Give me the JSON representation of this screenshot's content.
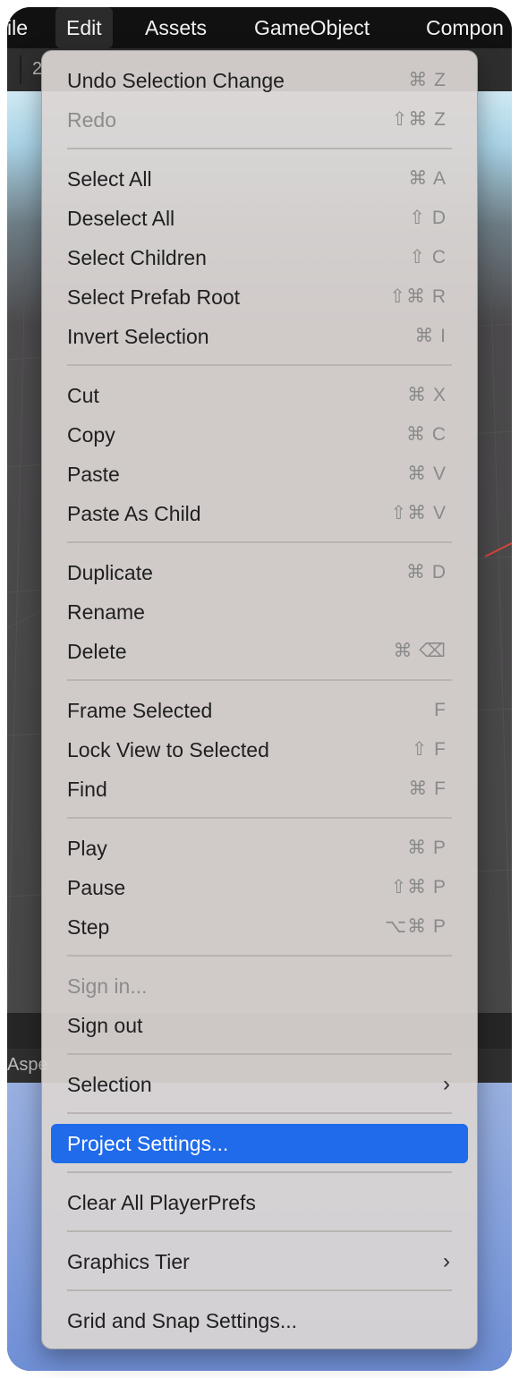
{
  "menubar": {
    "items": [
      "ile",
      "Edit",
      "Assets",
      "GameObject",
      "Compon"
    ]
  },
  "toolbar": {
    "partial_text": "2"
  },
  "scene": {
    "aspect_partial": "Aspe"
  },
  "edit_menu": {
    "items": [
      {
        "label": "Undo Selection Change",
        "shortcut": "⌘ Z"
      },
      {
        "label": "Redo",
        "shortcut": "⇧⌘ Z"
      },
      {
        "label": "Select All",
        "shortcut": "⌘ A"
      },
      {
        "label": "Deselect All",
        "shortcut": "⇧ D"
      },
      {
        "label": "Select Children",
        "shortcut": "⇧ C"
      },
      {
        "label": "Select Prefab Root",
        "shortcut": "⇧⌘ R"
      },
      {
        "label": "Invert Selection",
        "shortcut": "⌘ I"
      },
      {
        "label": "Cut",
        "shortcut": "⌘ X"
      },
      {
        "label": "Copy",
        "shortcut": "⌘ C"
      },
      {
        "label": "Paste",
        "shortcut": "⌘ V"
      },
      {
        "label": "Paste As Child",
        "shortcut": "⇧⌘ V"
      },
      {
        "label": "Duplicate",
        "shortcut": "⌘ D"
      },
      {
        "label": "Rename",
        "shortcut": ""
      },
      {
        "label": "Delete",
        "shortcut": "⌘ ⌫"
      },
      {
        "label": "Frame Selected",
        "shortcut": "F"
      },
      {
        "label": "Lock View to Selected",
        "shortcut": "⇧ F"
      },
      {
        "label": "Find",
        "shortcut": "⌘ F"
      },
      {
        "label": "Play",
        "shortcut": "⌘ P"
      },
      {
        "label": "Pause",
        "shortcut": "⇧⌘ P"
      },
      {
        "label": "Step",
        "shortcut": "⌥⌘ P"
      },
      {
        "label": "Sign in...",
        "shortcut": ""
      },
      {
        "label": "Sign out",
        "shortcut": ""
      },
      {
        "label": "Selection",
        "shortcut": ""
      },
      {
        "label": "Project Settings...",
        "shortcut": ""
      },
      {
        "label": "Clear All PlayerPrefs",
        "shortcut": ""
      },
      {
        "label": "Graphics Tier",
        "shortcut": ""
      },
      {
        "label": "Grid and Snap Settings...",
        "shortcut": ""
      }
    ],
    "submenu_icon": "chevron-right-icon",
    "highlight_color": "#1f6bea",
    "disabled_items": [
      "Redo",
      "Sign in..."
    ],
    "highlighted_item": "Project Settings..."
  }
}
